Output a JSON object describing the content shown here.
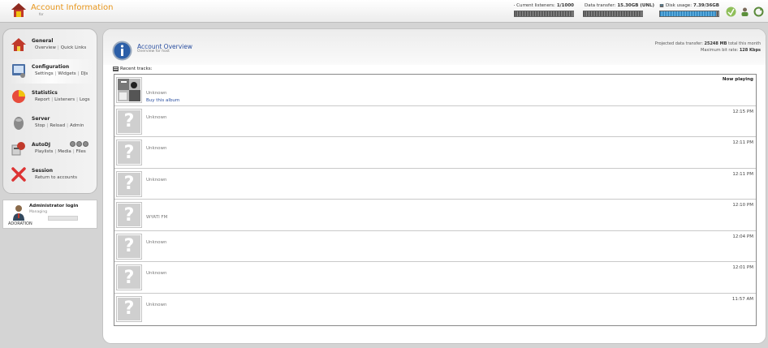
{
  "header": {
    "title": "Account Information",
    "subtitle": "for",
    "meters": [
      {
        "label": "Current listeners:",
        "value": "1/1000",
        "fill": 0.0
      },
      {
        "label": "Data transfer:",
        "value": "15.30GB (UNL)",
        "fill": 0.0
      },
      {
        "label": "Disk usage:",
        "value": "7.39/36GB",
        "fill": 0.96
      }
    ],
    "icons": [
      "status-icon",
      "account-icon",
      "refresh-icon"
    ]
  },
  "nav": [
    {
      "title": "General",
      "links": [
        "Overview",
        "Quick Links"
      ],
      "icon": "house-icon"
    },
    {
      "title": "Configuration",
      "links": [
        "Settings",
        "Widgets",
        "DJs"
      ],
      "icon": "configuration-icon"
    },
    {
      "title": "Statistics",
      "links": [
        "Report",
        "Listeners",
        "Logs"
      ],
      "icon": "pie-chart-icon"
    },
    {
      "title": "Server",
      "links": [
        "Stop",
        "Reload",
        "Admin"
      ],
      "icon": "server-icon"
    },
    {
      "title": "AutoDJ",
      "links": [
        "Playlists",
        "Media",
        "Files"
      ],
      "icon": "autodj-icon"
    },
    {
      "title": "Session",
      "links": [
        "Return to accounts"
      ],
      "icon": "logout-x-icon"
    }
  ],
  "admin": {
    "title": "Administrator login",
    "subtitle": "Managing",
    "account": "ADORATION"
  },
  "main": {
    "title": "Account Overview",
    "subtitle": "Overview for host",
    "projected_label": "Projected data transfer:",
    "projected_value": "25248 MB",
    "projected_suffix": "total this month",
    "bitrate_label": "Maximum bit rate:",
    "bitrate_value": "128 Kbps",
    "recent_label": "Recent tracks:",
    "now_playing": "Now playing",
    "buy_label": "Buy this album",
    "tracks": [
      {
        "title": "Unknown",
        "time": ""
      },
      {
        "title": "Unknown",
        "time": "12:15 PM"
      },
      {
        "title": "Unknown",
        "time": "12:11 PM"
      },
      {
        "title": "Unknown",
        "time": "12:11 PM"
      },
      {
        "title": "WYATI FM",
        "time": "12:10 PM"
      },
      {
        "title": "Unknown",
        "time": "12:04 PM"
      },
      {
        "title": "Unknown",
        "time": "12:01 PM"
      },
      {
        "title": "Unknown",
        "time": "11:57 AM"
      }
    ],
    "placeholder_glyph": "?"
  },
  "colors": {
    "accent": "#e8961c",
    "link": "#2a4fa0",
    "meter_fill": "#3a9ad9"
  }
}
